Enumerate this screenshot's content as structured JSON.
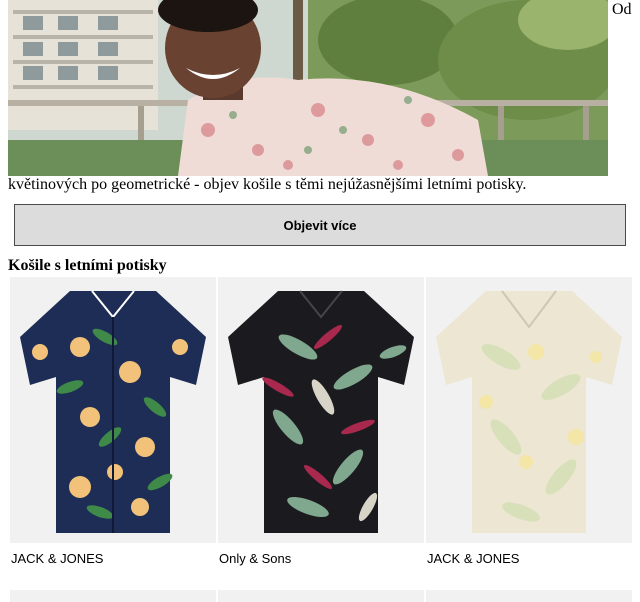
{
  "hero": {
    "image_alt": "Muž v letní květované košili",
    "float_text": "Od",
    "text": "květinových po geometrické - objev košile s těmi nejúžasnějšími letními potisky."
  },
  "cta": {
    "label": "Objevit více"
  },
  "section": {
    "title": "Košile s letními potisky",
    "products": [
      {
        "brand": "JACK & JONES",
        "image": "navy-tropical-shirt"
      },
      {
        "brand": "Only & Sons",
        "image": "black-tropical-shirt"
      },
      {
        "brand": "JACK & JONES",
        "image": "beige-tropical-shirt"
      }
    ]
  }
}
